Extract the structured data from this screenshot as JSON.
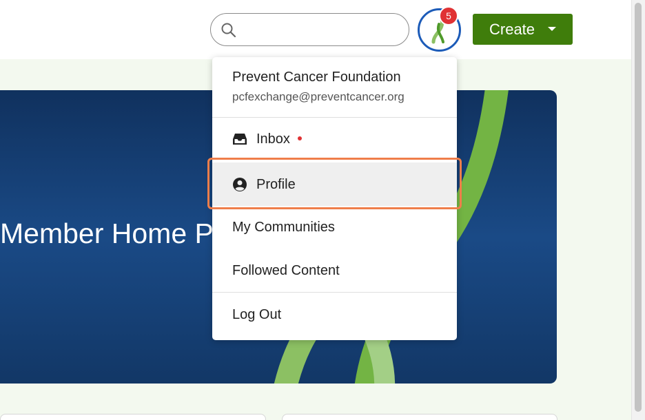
{
  "search": {
    "placeholder": "",
    "value": ""
  },
  "notifications": {
    "count": "5"
  },
  "create_button": {
    "label": "Create"
  },
  "hero": {
    "title": "Member Home Page"
  },
  "user_menu": {
    "name": "Prevent Cancer Foundation",
    "email": "pcfexchange@preventcancer.org",
    "items": [
      {
        "label": "Inbox",
        "icon": "inbox-icon",
        "unread": true
      },
      {
        "label": "Profile",
        "icon": "user-circle-icon",
        "highlighted": true
      },
      {
        "label": "My Communities"
      },
      {
        "label": "Followed Content"
      },
      {
        "label": "Log Out"
      }
    ]
  },
  "colors": {
    "brand_green": "#3f7d0b",
    "hero_blue": "#1a4a86",
    "ribbon_green": "#6fb33f",
    "badge_red": "#e03234",
    "highlight_orange": "#ef7e4a",
    "avatar_ring": "#1c5bb8"
  }
}
